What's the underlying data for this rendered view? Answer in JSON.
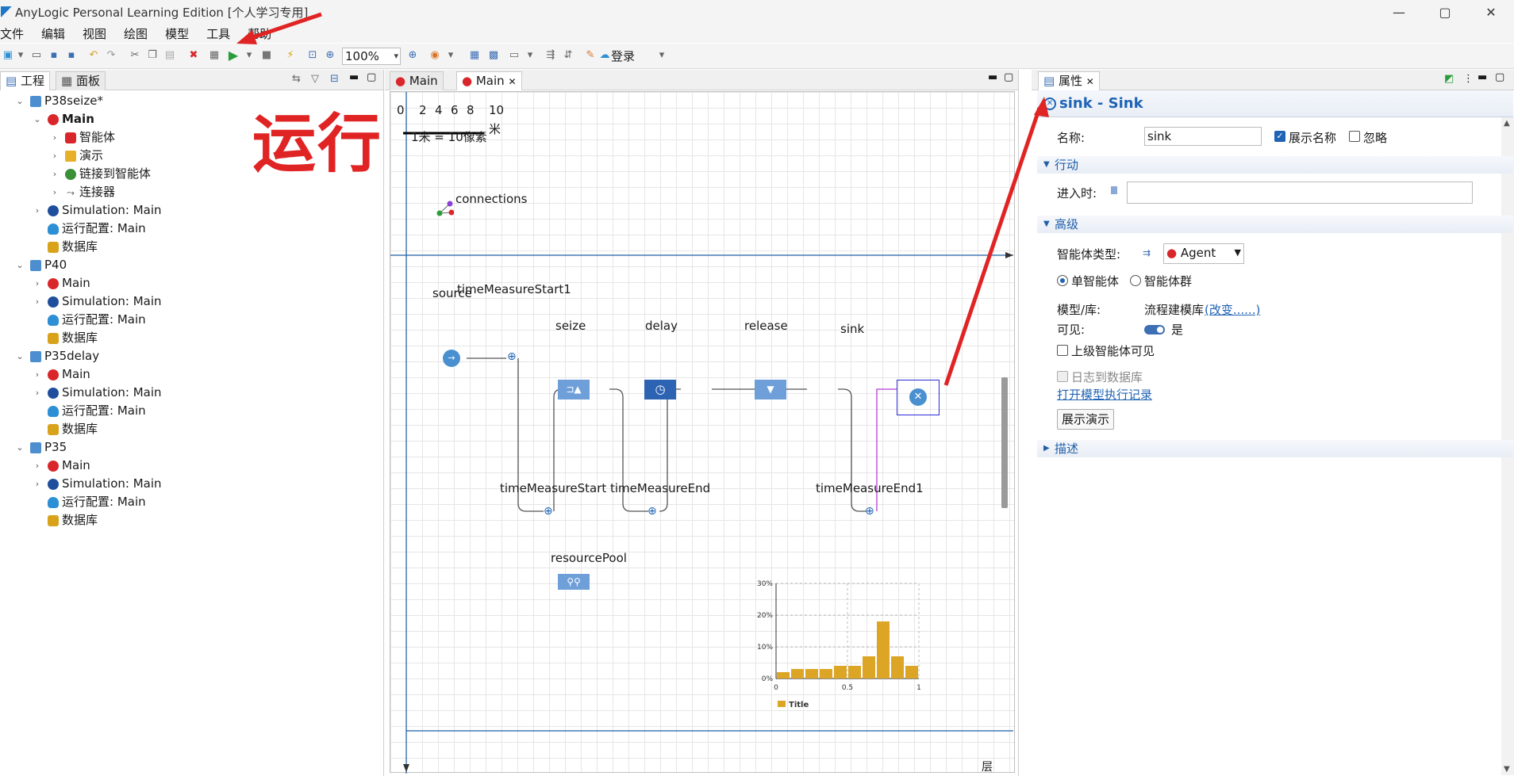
{
  "window": {
    "title": "AnyLogic Personal Learning Edition [个人学习专用]",
    "min": "—",
    "max": "▢",
    "close": "✕"
  },
  "menu": [
    "文件",
    "编辑",
    "视图",
    "绘图",
    "模型",
    "工具",
    "帮助"
  ],
  "toolbar": {
    "zoom": "100%",
    "login": "登录"
  },
  "left_panel": {
    "tabs": [
      "工程",
      "面板"
    ],
    "tree": [
      {
        "label": "P38seize*",
        "icon": "project-icon",
        "level": 0,
        "arrow": "v"
      },
      {
        "label": "Main",
        "icon": "agent-icon",
        "level": 1,
        "arrow": "v",
        "bold": true
      },
      {
        "label": "智能体",
        "icon": "agents-icon",
        "level": 2,
        "arrow": ">"
      },
      {
        "label": "演示",
        "icon": "presentation-icon",
        "level": 2,
        "arrow": ">"
      },
      {
        "label": "链接到智能体",
        "icon": "link-icon",
        "level": 2,
        "arrow": ">"
      },
      {
        "label": "连接器",
        "icon": "connector-icon",
        "level": 2,
        "arrow": ">"
      },
      {
        "label": "Simulation: Main",
        "icon": "simulation-icon",
        "level": 1,
        "arrow": ">"
      },
      {
        "label": "运行配置: Main",
        "icon": "run-config-icon",
        "level": 1,
        "arrow": ""
      },
      {
        "label": "数据库",
        "icon": "database-icon",
        "level": 1,
        "arrow": ""
      },
      {
        "label": "P40",
        "icon": "project-icon",
        "level": 0,
        "arrow": "v"
      },
      {
        "label": "Main",
        "icon": "agent-icon",
        "level": 1,
        "arrow": ">"
      },
      {
        "label": "Simulation: Main",
        "icon": "simulation-icon",
        "level": 1,
        "arrow": ">"
      },
      {
        "label": "运行配置: Main",
        "icon": "run-config-icon",
        "level": 1,
        "arrow": ""
      },
      {
        "label": "数据库",
        "icon": "database-icon",
        "level": 1,
        "arrow": ""
      },
      {
        "label": "P35delay",
        "icon": "project-icon",
        "level": 0,
        "arrow": "v"
      },
      {
        "label": "Main",
        "icon": "agent-icon",
        "level": 1,
        "arrow": ">"
      },
      {
        "label": "Simulation: Main",
        "icon": "simulation-icon",
        "level": 1,
        "arrow": ">"
      },
      {
        "label": "运行配置: Main",
        "icon": "run-config-icon",
        "level": 1,
        "arrow": ""
      },
      {
        "label": "数据库",
        "icon": "database-icon",
        "level": 1,
        "arrow": ""
      },
      {
        "label": "P35",
        "icon": "project-icon",
        "level": 0,
        "arrow": "v"
      },
      {
        "label": "Main",
        "icon": "agent-icon",
        "level": 1,
        "arrow": ">"
      },
      {
        "label": "Simulation: Main",
        "icon": "simulation-icon",
        "level": 1,
        "arrow": ">"
      },
      {
        "label": "运行配置: Main",
        "icon": "run-config-icon",
        "level": 1,
        "arrow": ""
      },
      {
        "label": "数据库",
        "icon": "database-icon",
        "level": 1,
        "arrow": ""
      }
    ]
  },
  "editor": {
    "tabs": [
      "Main",
      "Main"
    ],
    "scale": {
      "ticks": [
        "0",
        "2",
        "4",
        "6",
        "8",
        "10"
      ],
      "unit": "米",
      "caption": "1米 = 10像素"
    },
    "connections_label": "connections",
    "blocks": {
      "source": "source",
      "timeMeasureStart1": "timeMeasureStart1",
      "seize": "seize",
      "delay": "delay",
      "release": "release",
      "sink": "sink",
      "timeMeasureStart": "timeMeasureStart",
      "timeMeasureEnd": "timeMeasureEnd",
      "timeMeasureEnd1": "timeMeasureEnd1",
      "resourcePool": "resourcePool"
    },
    "layer_label": "层"
  },
  "chart_data": {
    "type": "bar",
    "x": [
      0.05,
      0.15,
      0.25,
      0.35,
      0.45,
      0.55,
      0.65,
      0.75,
      0.85,
      0.95
    ],
    "values": [
      2,
      3,
      3,
      3,
      4,
      4,
      7,
      18,
      7,
      4
    ],
    "xticks": [
      "0",
      "0.5",
      "1"
    ],
    "yticks": [
      "0%",
      "10%",
      "20%",
      "30%"
    ],
    "ylim": [
      0,
      30
    ],
    "xlim": [
      0,
      1
    ],
    "legend": "Title",
    "color": "#dca526"
  },
  "annotation": {
    "text": "运行",
    "color": "#e02424"
  },
  "properties": {
    "tab": "属性",
    "header": "sink - Sink",
    "name_label": "名称:",
    "name_value": "sink",
    "show_name": "展示名称",
    "ignore": "忽略",
    "sec_action": "行动",
    "on_enter": "进入时:",
    "sec_advanced": "高级",
    "agent_type_label": "智能体类型:",
    "agent_type_value": "Agent",
    "single_agent": "单智能体",
    "agent_population": "智能体群",
    "model_lib_label": "模型/库:",
    "model_lib_value": "流程建模库",
    "change_link": "(改变......)",
    "visible_label": "可见:",
    "visible_value": "是",
    "upper_visible": "上级智能体可见",
    "log_db": "日志到数据库",
    "open_log": "打开模型执行记录",
    "show_demo": "展示演示",
    "sec_desc": "描述"
  }
}
